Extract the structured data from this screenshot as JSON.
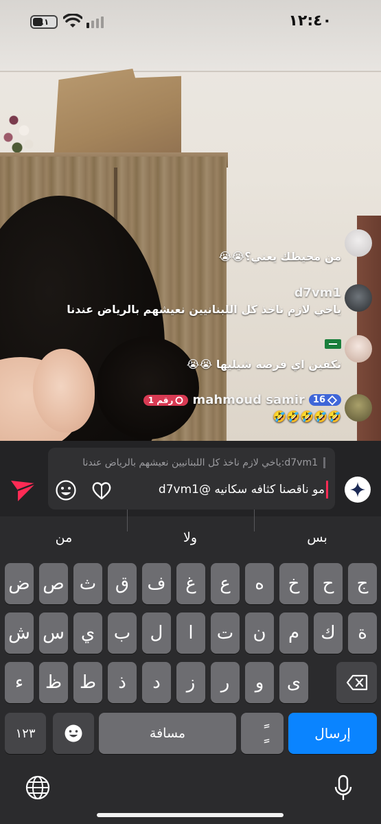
{
  "status": {
    "time": "١٢:٤٠",
    "battery": "٤١"
  },
  "comments": [
    {
      "user": "",
      "text": "من محيطك يعني؟😭😭"
    },
    {
      "user": "d7vm1",
      "text": "ياخي لازم ناخذ كل اللبنانيين نعيشهم بالرياض عندنا"
    },
    {
      "user": "",
      "text": "تكفين اي فرصه شيليها 😭😭"
    },
    {
      "user": "mahmoud samir",
      "level": "16",
      "rank": "رقم 1",
      "text": "🤣🤣🤣🤣🤣"
    }
  ],
  "compose": {
    "reply_to": "d7vm1:ياخي لازم ناخذ كل اللبنانيين نعيشهم بالرياض عندنا",
    "text": "مو ناقصنا كثافه سكانيه @d7vm1"
  },
  "keyboard": {
    "suggestions": [
      "بس",
      "ولا",
      "من"
    ],
    "row1": [
      "ج",
      "ح",
      "خ",
      "ه",
      "ع",
      "غ",
      "ف",
      "ق",
      "ث",
      "ص",
      "ض"
    ],
    "row2": [
      "ة",
      "ك",
      "م",
      "ن",
      "ت",
      "ا",
      "ل",
      "ب",
      "ي",
      "س",
      "ش"
    ],
    "row3": [
      "ى",
      "و",
      "ر",
      "ز",
      "د",
      "ذ",
      "ط",
      "ظ",
      "ء"
    ],
    "numbers_label": "١٢٣",
    "space_label": "مسافة",
    "tanween_label": "ًٍ",
    "send_label": "إرسال"
  },
  "colors": {
    "send_key": "#0a84ff",
    "caret": "#ff2b55",
    "level_badge": "#3f66d8",
    "rank_badge": "#d83a53"
  }
}
